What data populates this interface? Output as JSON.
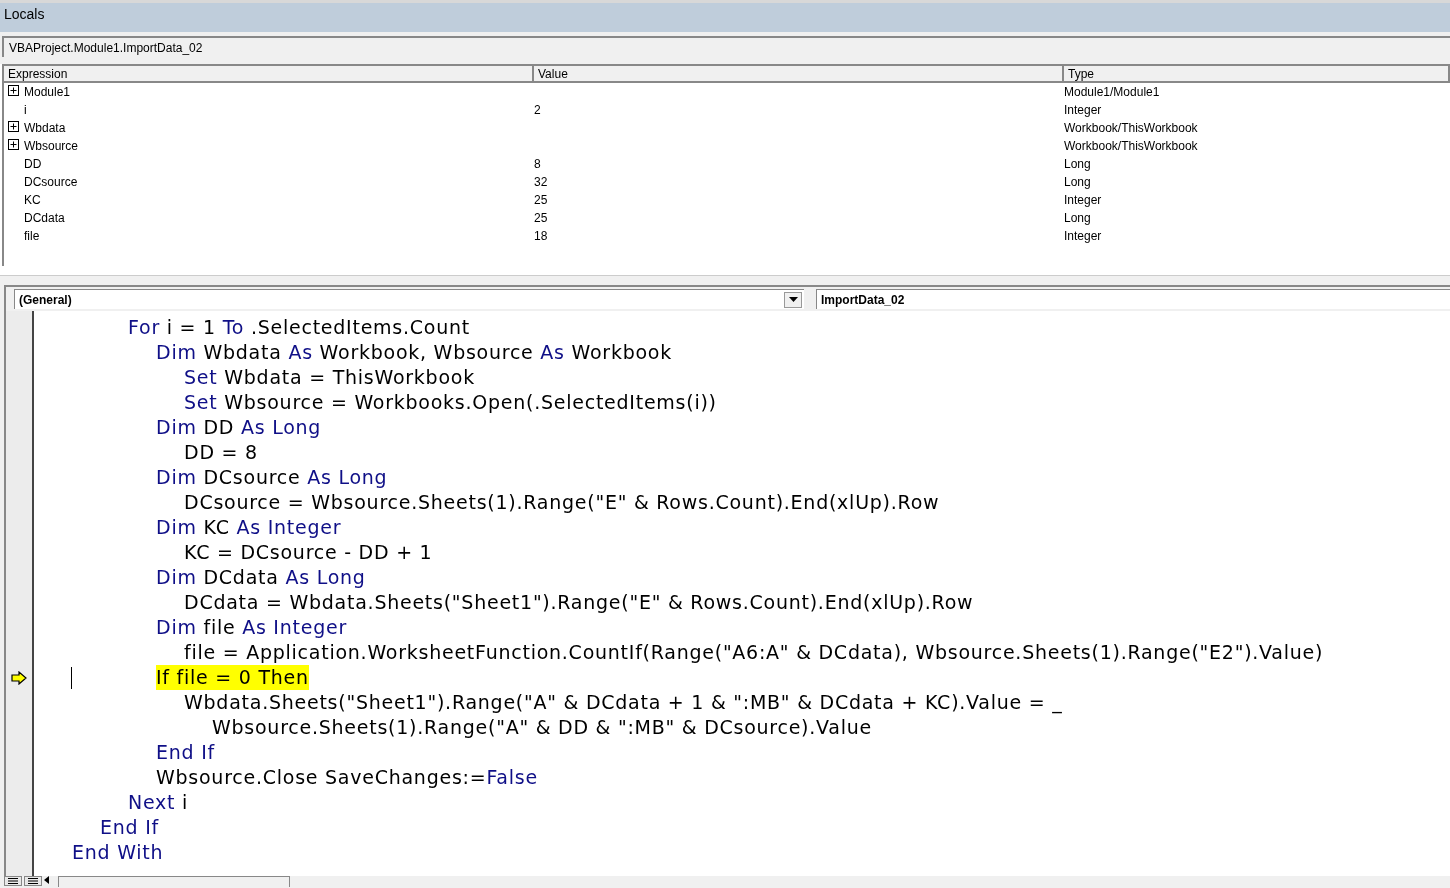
{
  "locals": {
    "title": "Locals",
    "context": "VBAProject.Module1.ImportData_02",
    "columns": [
      "Expression",
      "Value",
      "Type"
    ],
    "rows": [
      {
        "expression": "Module1",
        "value": "",
        "type": "Module1/Module1",
        "expandable": true
      },
      {
        "expression": "i",
        "value": "2",
        "type": "Integer",
        "expandable": false
      },
      {
        "expression": "Wbdata",
        "value": "",
        "type": "Workbook/ThisWorkbook",
        "expandable": true
      },
      {
        "expression": "Wbsource",
        "value": "",
        "type": "Workbook/ThisWorkbook",
        "expandable": true
      },
      {
        "expression": "DD",
        "value": "8",
        "type": "Long",
        "expandable": false
      },
      {
        "expression": "DCsource",
        "value": "32",
        "type": "Long",
        "expandable": false
      },
      {
        "expression": "KC",
        "value": "25",
        "type": "Integer",
        "expandable": false
      },
      {
        "expression": "DCdata",
        "value": "25",
        "type": "Long",
        "expandable": false
      },
      {
        "expression": "file",
        "value": "18",
        "type": "Integer",
        "expandable": false
      }
    ]
  },
  "code_window": {
    "object_dropdown": "(General)",
    "procedure_dropdown": "ImportData_02",
    "lines": [
      {
        "children": [
          {
            "children": [
              {
                "current": false,
                "highlighted": false,
                "segments": [
                  {
                    "kind": "keyword",
                    "text": "For"
                  },
                  {
                    "kind": "plain",
                    "text": " i = 1 "
                  },
                  {
                    "kind": "keyword",
                    "text": "To"
                  },
                  {
                    "kind": "plain",
                    "text": " .SelectedItems.Count"
                  }
                ],
                "children": [
                  {
                    "current": false,
                    "highlighted": false,
                    "segments": [
                      {
                        "kind": "keyword",
                        "text": "Dim"
                      },
                      {
                        "kind": "plain",
                        "text": " Wbdata "
                      },
                      {
                        "kind": "keyword",
                        "text": "As"
                      },
                      {
                        "kind": "plain",
                        "text": " Workbook, Wbsource "
                      },
                      {
                        "kind": "keyword",
                        "text": "As"
                      },
                      {
                        "kind": "plain",
                        "text": " Workbook"
                      }
                    ],
                    "children": [
                      {
                        "current": false,
                        "highlighted": false,
                        "segments": [
                          {
                            "kind": "keyword",
                            "text": "Set"
                          },
                          {
                            "kind": "plain",
                            "text": " Wbdata = ThisWorkbook"
                          }
                        ]
                      },
                      {
                        "current": false,
                        "highlighted": false,
                        "segments": [
                          {
                            "kind": "keyword",
                            "text": "Set"
                          },
                          {
                            "kind": "plain",
                            "text": " Wbsource = Workbooks.Open(.SelectedItems(i))"
                          }
                        ]
                      }
                    ]
                  },
                  {
                    "current": false,
                    "highlighted": false,
                    "segments": [
                      {
                        "kind": "keyword",
                        "text": "Dim"
                      },
                      {
                        "kind": "plain",
                        "text": " DD "
                      },
                      {
                        "kind": "keyword",
                        "text": "As Long"
                      }
                    ],
                    "children": [
                      {
                        "current": false,
                        "highlighted": false,
                        "segments": [
                          {
                            "kind": "plain",
                            "text": "DD = 8"
                          }
                        ]
                      }
                    ]
                  },
                  {
                    "current": false,
                    "highlighted": false,
                    "segments": [
                      {
                        "kind": "keyword",
                        "text": "Dim"
                      },
                      {
                        "kind": "plain",
                        "text": " DCsource "
                      },
                      {
                        "kind": "keyword",
                        "text": "As Long"
                      }
                    ],
                    "children": [
                      {
                        "current": false,
                        "highlighted": false,
                        "segments": [
                          {
                            "kind": "plain",
                            "text": "DCsource = Wbsource.Sheets(1).Range(\"E\" & Rows.Count).End(xlUp).Row"
                          }
                        ]
                      }
                    ]
                  },
                  {
                    "current": false,
                    "highlighted": false,
                    "segments": [
                      {
                        "kind": "keyword",
                        "text": "Dim"
                      },
                      {
                        "kind": "plain",
                        "text": " KC "
                      },
                      {
                        "kind": "keyword",
                        "text": "As Integer"
                      }
                    ],
                    "children": [
                      {
                        "current": false,
                        "highlighted": false,
                        "segments": [
                          {
                            "kind": "plain",
                            "text": "KC = DCsource - DD + 1"
                          }
                        ]
                      }
                    ]
                  },
                  {
                    "current": false,
                    "highlighted": false,
                    "segments": [
                      {
                        "kind": "keyword",
                        "text": "Dim"
                      },
                      {
                        "kind": "plain",
                        "text": " DCdata "
                      },
                      {
                        "kind": "keyword",
                        "text": "As Long"
                      }
                    ],
                    "children": [
                      {
                        "current": false,
                        "highlighted": false,
                        "segments": [
                          {
                            "kind": "plain",
                            "text": "DCdata = Wbdata.Sheets(\"Sheet1\").Range(\"E\" & Rows.Count).End(xlUp).Row"
                          }
                        ]
                      }
                    ]
                  },
                  {
                    "current": false,
                    "highlighted": false,
                    "segments": [
                      {
                        "kind": "keyword",
                        "text": "Dim"
                      },
                      {
                        "kind": "plain",
                        "text": " file "
                      },
                      {
                        "kind": "keyword",
                        "text": "As Integer"
                      }
                    ],
                    "children": [
                      {
                        "current": false,
                        "highlighted": false,
                        "segments": [
                          {
                            "kind": "plain",
                            "text": "file = Application.WorksheetFunction.CountIf(Range(\"A6:A\" & DCdata), Wbsource.Sheets(1).Range(\"E2\").Value)"
                          }
                        ]
                      }
                    ]
                  },
                  {
                    "current": true,
                    "highlighted": true,
                    "segments": [
                      {
                        "kind": "plain",
                        "text": "If file = 0 Then"
                      }
                    ],
                    "children": [
                      {
                        "current": false,
                        "highlighted": false,
                        "segments": [
                          {
                            "kind": "plain",
                            "text": "Wbdata.Sheets(\"Sheet1\").Range(\"A\" & DCdata + 1 & \":MB\" & DCdata + KC).Value = _"
                          }
                        ],
                        "children": [
                          {
                            "current": false,
                            "highlighted": false,
                            "segments": [
                              {
                                "kind": "plain",
                                "text": "Wbsource.Sheets(1).Range(\"A\" & DD & \":MB\" & DCsource).Value"
                              }
                            ]
                          }
                        ]
                      }
                    ]
                  },
                  {
                    "current": false,
                    "highlighted": false,
                    "segments": [
                      {
                        "kind": "keyword",
                        "text": "End If"
                      }
                    ]
                  },
                  {
                    "current": false,
                    "highlighted": false,
                    "segments": [
                      {
                        "kind": "plain",
                        "text": "Wbsource.Close SaveChanges:="
                      },
                      {
                        "kind": "keyword",
                        "text": "False"
                      }
                    ]
                  }
                ]
              },
              {
                "current": false,
                "highlighted": false,
                "segments": [
                  {
                    "kind": "keyword",
                    "text": "Next"
                  },
                  {
                    "kind": "plain",
                    "text": " i"
                  }
                ]
              }
            ]
          },
          {
            "current": false,
            "highlighted": false,
            "segments": [
              {
                "kind": "keyword",
                "text": "End If"
              }
            ]
          }
        ]
      },
      {
        "current": false,
        "highlighted": false,
        "segments": [
          {
            "kind": "keyword",
            "text": "End With"
          }
        ]
      }
    ]
  }
}
